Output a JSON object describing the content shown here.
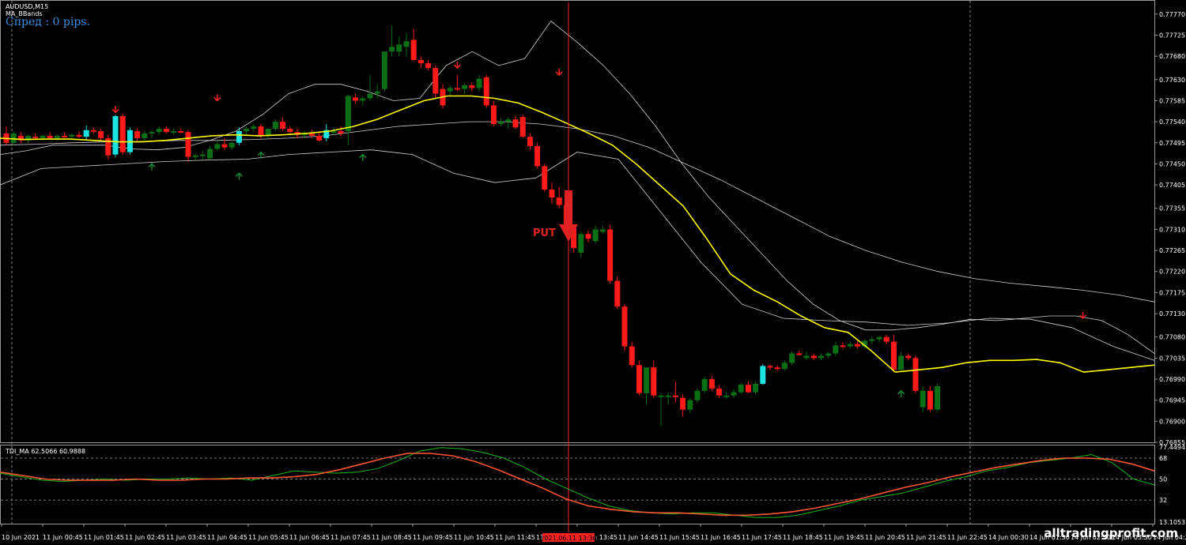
{
  "header": {
    "symbol_timeframe": "AUDUSD,M15",
    "indicator_name": "MA_BBands",
    "spread_text": "Спред : 0 pips."
  },
  "signal": {
    "label": "PUT",
    "cursor_time_label": "2021.06.11 13:30"
  },
  "lower_panel": {
    "title": "TDI_MA 62.5066 60.9888",
    "axis_labels": [
      "77.4494",
      "68",
      "50",
      "32",
      "13.1053"
    ],
    "levels": [
      68,
      50,
      32
    ],
    "range": [
      13.1053,
      77.4494
    ]
  },
  "watermark": "alltradingprofit.com",
  "colors": {
    "background": "#000000",
    "bull_candle": "#0a6e14",
    "bear_candle": "#ff1a1a",
    "highlight_candle": "#1de2e2",
    "ma_line": "#ffff00",
    "bbands": "#d0d0d0",
    "cursor_line": "#ff2020",
    "tdi_green": "#18b418",
    "tdi_red": "#ff5533",
    "up_arrow": "#1a8a3a",
    "down_arrow": "#ff2222"
  },
  "chart_data": {
    "type": "candlestick",
    "symbol": "AUDUSD",
    "timeframe": "M15",
    "price_axis_labels": [
      "0.77770",
      "0.77725",
      "0.77680",
      "0.77630",
      "0.77585",
      "0.77540",
      "0.77495",
      "0.77450",
      "0.77405",
      "0.77355",
      "0.77310",
      "0.77265",
      "0.77220",
      "0.77175",
      "0.77130",
      "0.77080",
      "0.77035",
      "0.76990",
      "0.76945",
      "0.76900",
      "0.76855"
    ],
    "price_range": [
      0.76855,
      0.7779
    ],
    "time_axis_labels": [
      "10 Jun 2021",
      "11 Jun 00:45",
      "11 Jun 01:45",
      "11 Jun 02:45",
      "11 Jun 03:45",
      "11 Jun 04:45",
      "11 Jun 05:45",
      "11 Jun 06:45",
      "11 Jun 07:45",
      "11 Jun 08:45",
      "11 Jun 09:45",
      "11 Jun 10:45",
      "11 Jun 11:45",
      "11 Jun 12:45",
      "11 Jun 13:45",
      "11 Jun 14:45",
      "11 Jun 15:45",
      "11 Jun 16:45",
      "11 Jun 17:45",
      "11 Jun 18:45",
      "11 Jun 19:45",
      "11 Jun 20:45",
      "11 Jun 21:45",
      "11 Jun 22:45",
      "14 Jun 00:30",
      "14 Jun 01:30",
      "14 Jun 02:30",
      "14 Jun 03:30",
      "14 Jun 04:30"
    ],
    "candles": [
      {
        "o": 0.77515,
        "h": 0.7753,
        "l": 0.7749,
        "c": 0.77495
      },
      {
        "o": 0.77495,
        "h": 0.7752,
        "l": 0.7749,
        "c": 0.77515
      },
      {
        "o": 0.7751,
        "h": 0.77518,
        "l": 0.77495,
        "c": 0.775
      },
      {
        "o": 0.775,
        "h": 0.77512,
        "l": 0.77495,
        "c": 0.7751
      },
      {
        "o": 0.77508,
        "h": 0.77515,
        "l": 0.775,
        "c": 0.77505
      },
      {
        "o": 0.77505,
        "h": 0.77512,
        "l": 0.775,
        "c": 0.7751
      },
      {
        "o": 0.7751,
        "h": 0.77518,
        "l": 0.77502,
        "c": 0.77505
      },
      {
        "o": 0.77505,
        "h": 0.77512,
        "l": 0.775,
        "c": 0.7751
      },
      {
        "o": 0.7751,
        "h": 0.77518,
        "l": 0.77505,
        "c": 0.77508
      },
      {
        "o": 0.77508,
        "h": 0.77515,
        "l": 0.775,
        "c": 0.77512
      },
      {
        "o": 0.77512,
        "h": 0.7752,
        "l": 0.77505,
        "c": 0.77508
      },
      {
        "o": 0.77508,
        "h": 0.77532,
        "l": 0.775,
        "c": 0.77522,
        "hl": true
      },
      {
        "o": 0.77522,
        "h": 0.77528,
        "l": 0.77515,
        "c": 0.7752
      },
      {
        "o": 0.7752,
        "h": 0.77525,
        "l": 0.775,
        "c": 0.77505
      },
      {
        "o": 0.77505,
        "h": 0.77512,
        "l": 0.7746,
        "c": 0.77468
      },
      {
        "o": 0.7747,
        "h": 0.77555,
        "l": 0.77465,
        "c": 0.77552,
        "hl": true
      },
      {
        "o": 0.77552,
        "h": 0.77558,
        "l": 0.7747,
        "c": 0.77475
      },
      {
        "o": 0.77475,
        "h": 0.77528,
        "l": 0.7747,
        "c": 0.77522,
        "hl": true
      },
      {
        "o": 0.7752,
        "h": 0.77525,
        "l": 0.775,
        "c": 0.77505
      },
      {
        "o": 0.77505,
        "h": 0.7752,
        "l": 0.775,
        "c": 0.77515
      },
      {
        "o": 0.77515,
        "h": 0.77522,
        "l": 0.77505,
        "c": 0.77518
      },
      {
        "o": 0.77518,
        "h": 0.7753,
        "l": 0.77512,
        "c": 0.77525
      },
      {
        "o": 0.77525,
        "h": 0.7753,
        "l": 0.77515,
        "c": 0.77518
      },
      {
        "o": 0.77518,
        "h": 0.77525,
        "l": 0.77512,
        "c": 0.7752
      },
      {
        "o": 0.7752,
        "h": 0.77525,
        "l": 0.77515,
        "c": 0.77518
      },
      {
        "o": 0.77518,
        "h": 0.77522,
        "l": 0.77455,
        "c": 0.77465
      },
      {
        "o": 0.77465,
        "h": 0.77472,
        "l": 0.77458,
        "c": 0.77468
      },
      {
        "o": 0.77468,
        "h": 0.77478,
        "l": 0.7746,
        "c": 0.7747
      },
      {
        "o": 0.77462,
        "h": 0.77488,
        "l": 0.77458,
        "c": 0.77482
      },
      {
        "o": 0.77482,
        "h": 0.77498,
        "l": 0.77478,
        "c": 0.77492
      },
      {
        "o": 0.77492,
        "h": 0.77505,
        "l": 0.7748,
        "c": 0.77485
      },
      {
        "o": 0.77485,
        "h": 0.77498,
        "l": 0.7748,
        "c": 0.77495
      },
      {
        "o": 0.77495,
        "h": 0.77528,
        "l": 0.7749,
        "c": 0.7752,
        "hl": true
      },
      {
        "o": 0.7752,
        "h": 0.7753,
        "l": 0.77512,
        "c": 0.77525
      },
      {
        "o": 0.77525,
        "h": 0.77535,
        "l": 0.77518,
        "c": 0.7753
      },
      {
        "o": 0.7753,
        "h": 0.77535,
        "l": 0.77505,
        "c": 0.7751
      },
      {
        "o": 0.7751,
        "h": 0.77525,
        "l": 0.77505,
        "c": 0.77525
      },
      {
        "o": 0.77525,
        "h": 0.77545,
        "l": 0.7752,
        "c": 0.7754
      },
      {
        "o": 0.7754,
        "h": 0.77548,
        "l": 0.7752,
        "c": 0.77525
      },
      {
        "o": 0.77525,
        "h": 0.7753,
        "l": 0.77512,
        "c": 0.77518
      },
      {
        "o": 0.77518,
        "h": 0.77525,
        "l": 0.77505,
        "c": 0.77512
      },
      {
        "o": 0.77512,
        "h": 0.7752,
        "l": 0.77505,
        "c": 0.77515
      },
      {
        "o": 0.77515,
        "h": 0.77522,
        "l": 0.77505,
        "c": 0.7751
      },
      {
        "o": 0.7751,
        "h": 0.7752,
        "l": 0.77498,
        "c": 0.775
      },
      {
        "o": 0.77505,
        "h": 0.77535,
        "l": 0.77498,
        "c": 0.77522,
        "hl": true
      },
      {
        "o": 0.7752,
        "h": 0.77528,
        "l": 0.77512,
        "c": 0.7752
      },
      {
        "o": 0.7752,
        "h": 0.7753,
        "l": 0.7751,
        "c": 0.77515
      },
      {
        "o": 0.7752,
        "h": 0.77598,
        "l": 0.7749,
        "c": 0.77595
      },
      {
        "o": 0.77592,
        "h": 0.776,
        "l": 0.7758,
        "c": 0.77585
      },
      {
        "o": 0.77585,
        "h": 0.77595,
        "l": 0.77575,
        "c": 0.7759
      },
      {
        "o": 0.7759,
        "h": 0.7764,
        "l": 0.77585,
        "c": 0.776
      },
      {
        "o": 0.776,
        "h": 0.7762,
        "l": 0.7759,
        "c": 0.77605
      },
      {
        "o": 0.7761,
        "h": 0.7769,
        "l": 0.77605,
        "c": 0.7769
      },
      {
        "o": 0.7769,
        "h": 0.77745,
        "l": 0.7768,
        "c": 0.777
      },
      {
        "o": 0.7769,
        "h": 0.77722,
        "l": 0.7768,
        "c": 0.77705
      },
      {
        "o": 0.777,
        "h": 0.7773,
        "l": 0.7768,
        "c": 0.77712
      },
      {
        "o": 0.77715,
        "h": 0.77738,
        "l": 0.7767,
        "c": 0.77672
      },
      {
        "o": 0.77672,
        "h": 0.7768,
        "l": 0.77655,
        "c": 0.77665
      },
      {
        "o": 0.77665,
        "h": 0.77672,
        "l": 0.7765,
        "c": 0.77655
      },
      {
        "o": 0.77655,
        "h": 0.7766,
        "l": 0.7759,
        "c": 0.776
      },
      {
        "o": 0.7761,
        "h": 0.7762,
        "l": 0.77568,
        "c": 0.77575
      },
      {
        "o": 0.77605,
        "h": 0.77618,
        "l": 0.77595,
        "c": 0.77612
      },
      {
        "o": 0.77612,
        "h": 0.7764,
        "l": 0.77605,
        "c": 0.7761
      },
      {
        "o": 0.7761,
        "h": 0.77622,
        "l": 0.776,
        "c": 0.77618
      },
      {
        "o": 0.77618,
        "h": 0.77625,
        "l": 0.77605,
        "c": 0.77612
      },
      {
        "o": 0.77612,
        "h": 0.7764,
        "l": 0.77605,
        "c": 0.77632
      },
      {
        "o": 0.77635,
        "h": 0.7764,
        "l": 0.7757,
        "c": 0.77575
      },
      {
        "o": 0.77575,
        "h": 0.77585,
        "l": 0.7753,
        "c": 0.77535
      },
      {
        "o": 0.77535,
        "h": 0.77548,
        "l": 0.7753,
        "c": 0.7754
      },
      {
        "o": 0.7754,
        "h": 0.7755,
        "l": 0.77525,
        "c": 0.77545
      },
      {
        "o": 0.77545,
        "h": 0.77552,
        "l": 0.77525,
        "c": 0.77528
      },
      {
        "o": 0.7755,
        "h": 0.77555,
        "l": 0.77505,
        "c": 0.77508
      },
      {
        "o": 0.77508,
        "h": 0.77515,
        "l": 0.7748,
        "c": 0.77488
      },
      {
        "o": 0.77488,
        "h": 0.77495,
        "l": 0.7744,
        "c": 0.77445
      },
      {
        "o": 0.77445,
        "h": 0.7745,
        "l": 0.7739,
        "c": 0.77395
      },
      {
        "o": 0.77395,
        "h": 0.7741,
        "l": 0.77365,
        "c": 0.77378
      },
      {
        "o": 0.77378,
        "h": 0.774,
        "l": 0.77355,
        "c": 0.77362
      },
      {
        "o": 0.77362,
        "h": 0.77375,
        "l": 0.77305,
        "c": 0.77312
      },
      {
        "o": 0.77312,
        "h": 0.77318,
        "l": 0.7726,
        "c": 0.7727
      },
      {
        "o": 0.7726,
        "h": 0.77305,
        "l": 0.7725,
        "c": 0.773
      },
      {
        "o": 0.773,
        "h": 0.77308,
        "l": 0.77282,
        "c": 0.7729
      },
      {
        "o": 0.77285,
        "h": 0.77318,
        "l": 0.7728,
        "c": 0.7731
      },
      {
        "o": 0.77305,
        "h": 0.77318,
        "l": 0.773,
        "c": 0.7731
      },
      {
        "o": 0.7731,
        "h": 0.7732,
        "l": 0.77195,
        "c": 0.772
      },
      {
        "o": 0.772,
        "h": 0.7721,
        "l": 0.7714,
        "c": 0.77145
      },
      {
        "o": 0.77145,
        "h": 0.7715,
        "l": 0.7705,
        "c": 0.7706
      },
      {
        "o": 0.7706,
        "h": 0.7707,
        "l": 0.77015,
        "c": 0.7702
      },
      {
        "o": 0.7702,
        "h": 0.7703,
        "l": 0.76955,
        "c": 0.7696
      },
      {
        "o": 0.7696,
        "h": 0.76975,
        "l": 0.76935,
        "c": 0.77015
      },
      {
        "o": 0.77015,
        "h": 0.7703,
        "l": 0.7695,
        "c": 0.76955
      },
      {
        "o": 0.76955,
        "h": 0.7696,
        "l": 0.7689,
        "c": 0.76955
      },
      {
        "o": 0.76955,
        "h": 0.76962,
        "l": 0.76935,
        "c": 0.76955
      },
      {
        "o": 0.76955,
        "h": 0.76985,
        "l": 0.7694,
        "c": 0.76952
      },
      {
        "o": 0.7695,
        "h": 0.76958,
        "l": 0.7691,
        "c": 0.76925
      },
      {
        "o": 0.76925,
        "h": 0.7695,
        "l": 0.76918,
        "c": 0.76945
      },
      {
        "o": 0.76945,
        "h": 0.7697,
        "l": 0.7694,
        "c": 0.76965
      },
      {
        "o": 0.76965,
        "h": 0.76995,
        "l": 0.7696,
        "c": 0.7699
      },
      {
        "o": 0.7699,
        "h": 0.76998,
        "l": 0.76965,
        "c": 0.7697
      },
      {
        "o": 0.7697,
        "h": 0.76978,
        "l": 0.7695,
        "c": 0.76955
      },
      {
        "o": 0.76955,
        "h": 0.76962,
        "l": 0.76948,
        "c": 0.76955
      },
      {
        "o": 0.76955,
        "h": 0.76968,
        "l": 0.7695,
        "c": 0.76962
      },
      {
        "o": 0.76962,
        "h": 0.76982,
        "l": 0.76958,
        "c": 0.76978
      },
      {
        "o": 0.76978,
        "h": 0.76985,
        "l": 0.7696,
        "c": 0.76962
      },
      {
        "o": 0.76962,
        "h": 0.76985,
        "l": 0.76958,
        "c": 0.7698
      },
      {
        "o": 0.7698,
        "h": 0.77022,
        "l": 0.76978,
        "c": 0.77018,
        "hl": true
      },
      {
        "o": 0.77018,
        "h": 0.77022,
        "l": 0.7701,
        "c": 0.77015
      },
      {
        "o": 0.77015,
        "h": 0.7702,
        "l": 0.77008,
        "c": 0.77012
      },
      {
        "o": 0.77012,
        "h": 0.7703,
        "l": 0.77008,
        "c": 0.77025
      },
      {
        "o": 0.77025,
        "h": 0.7705,
        "l": 0.7702,
        "c": 0.77045
      },
      {
        "o": 0.77045,
        "h": 0.7705,
        "l": 0.7704,
        "c": 0.77042
      },
      {
        "o": 0.77035,
        "h": 0.77048,
        "l": 0.7703,
        "c": 0.7704
      },
      {
        "o": 0.7704,
        "h": 0.77045,
        "l": 0.7703,
        "c": 0.77035
      },
      {
        "o": 0.77035,
        "h": 0.77045,
        "l": 0.7703,
        "c": 0.7704
      },
      {
        "o": 0.7704,
        "h": 0.77048,
        "l": 0.77035,
        "c": 0.77045
      },
      {
        "o": 0.77045,
        "h": 0.77068,
        "l": 0.7704,
        "c": 0.77062
      },
      {
        "o": 0.77062,
        "h": 0.77068,
        "l": 0.77055,
        "c": 0.7706
      },
      {
        "o": 0.7706,
        "h": 0.7707,
        "l": 0.77055,
        "c": 0.77065
      },
      {
        "o": 0.77065,
        "h": 0.77072,
        "l": 0.77055,
        "c": 0.7706
      },
      {
        "o": 0.7706,
        "h": 0.77075,
        "l": 0.77055,
        "c": 0.77072
      },
      {
        "o": 0.77072,
        "h": 0.7708,
        "l": 0.77065,
        "c": 0.77075
      },
      {
        "o": 0.77075,
        "h": 0.77082,
        "l": 0.77068,
        "c": 0.7708
      },
      {
        "o": 0.7708,
        "h": 0.77085,
        "l": 0.77065,
        "c": 0.7707
      },
      {
        "o": 0.7707,
        "h": 0.77085,
        "l": 0.77005,
        "c": 0.7701
      },
      {
        "o": 0.7701,
        "h": 0.77048,
        "l": 0.77005,
        "c": 0.7704
      },
      {
        "o": 0.7704,
        "h": 0.77045,
        "l": 0.7703,
        "c": 0.77035
      },
      {
        "o": 0.77035,
        "h": 0.7704,
        "l": 0.7696,
        "c": 0.76965
      },
      {
        "o": 0.7693,
        "h": 0.76975,
        "l": 0.7692,
        "c": 0.76965
      },
      {
        "o": 0.76965,
        "h": 0.76975,
        "l": 0.7692,
        "c": 0.76925
      },
      {
        "o": 0.76925,
        "h": 0.7698,
        "l": 0.7692,
        "c": 0.76975
      }
    ],
    "ma": [
      0.77505,
      0.77502,
      0.77503,
      0.77503,
      0.775,
      0.77497,
      0.77497,
      0.775,
      0.77505,
      0.7751,
      0.77512,
      0.7751,
      0.77512,
      0.77515,
      0.7752,
      0.7753,
      0.77545,
      0.77565,
      0.77585,
      0.77595,
      0.77595,
      0.7759,
      0.7758,
      0.7756,
      0.77538,
      0.77515,
      0.7749,
      0.7745,
      0.77405,
      0.7736,
      0.7729,
      0.77215,
      0.7718,
      0.77155,
      0.77125,
      0.771,
      0.7709,
      0.7705,
      0.77005,
      0.7701,
      0.77015,
      0.77025,
      0.7703,
      0.7703,
      0.77032,
      0.77025,
      0.77005,
      0.7701,
      0.77015,
      0.7702
    ],
    "bb_upper": [
      0.7747,
      0.77478,
      0.7749,
      0.7749,
      0.7749,
      0.77482,
      0.7748,
      0.77485,
      0.775,
      0.7752,
      0.77555,
      0.776,
      0.7762,
      0.7762,
      0.77605,
      0.77585,
      0.7759,
      0.7766,
      0.7769,
      0.7766,
      0.77675,
      0.77755,
      0.7771,
      0.7766,
      0.776,
      0.7753,
      0.7745,
      0.7738,
      0.7732,
      0.7726,
      0.772,
      0.7715,
      0.77115,
      0.77095,
      0.77095,
      0.771,
      0.77108,
      0.77118,
      0.77115,
      0.7712,
      0.77125,
      0.77125,
      0.77115,
      0.77085,
      0.77045
    ],
    "bb_middle": [
      0.7749,
      0.77492,
      0.77495,
      0.77497,
      0.77498,
      0.775,
      0.775,
      0.77502,
      0.77505,
      0.7751,
      0.7752,
      0.7753,
      0.77535,
      0.7754,
      0.7754,
      0.77535,
      0.77525,
      0.7751,
      0.77485,
      0.7745,
      0.77415,
      0.77375,
      0.77335,
      0.77295,
      0.77265,
      0.7724,
      0.7722,
      0.77205,
      0.77195,
      0.77188,
      0.7718,
      0.7717,
      0.77155
    ],
    "bb_lower": [
      0.77405,
      0.7744,
      0.77445,
      0.7745,
      0.77455,
      0.77458,
      0.7746,
      0.7747,
      0.77475,
      0.7748,
      0.7747,
      0.7743,
      0.7741,
      0.7742,
      0.77475,
      0.7746,
      0.7735,
      0.7724,
      0.7715,
      0.7712,
      0.77115,
      0.77112,
      0.77105,
      0.7711,
      0.7712,
      0.77118,
      0.771,
      0.7706,
      0.7703
    ]
  },
  "tdi_data": {
    "green": [
      55,
      52,
      49,
      48,
      49,
      50,
      49,
      50,
      50,
      51,
      50,
      51,
      49,
      53,
      57,
      56,
      55,
      56,
      59,
      66,
      74,
      77,
      76,
      73,
      68,
      60,
      50,
      42,
      34,
      27,
      23,
      21,
      20,
      21,
      21,
      19,
      17,
      17,
      19,
      23,
      27,
      32,
      35,
      38,
      43,
      48,
      52,
      57,
      60,
      64,
      66,
      68,
      71,
      64,
      50,
      45
    ],
    "red": [
      56,
      53,
      50,
      49,
      49,
      49,
      50,
      49,
      49,
      50,
      50,
      51,
      51,
      52,
      54,
      58,
      63,
      68,
      72,
      72,
      70,
      65,
      58,
      50,
      42,
      33,
      27,
      24,
      22,
      21,
      21,
      20,
      19,
      19,
      20,
      22,
      25,
      29,
      33,
      38,
      43,
      47,
      52,
      56,
      60,
      63,
      66,
      68,
      68,
      67,
      63,
      57
    ]
  }
}
